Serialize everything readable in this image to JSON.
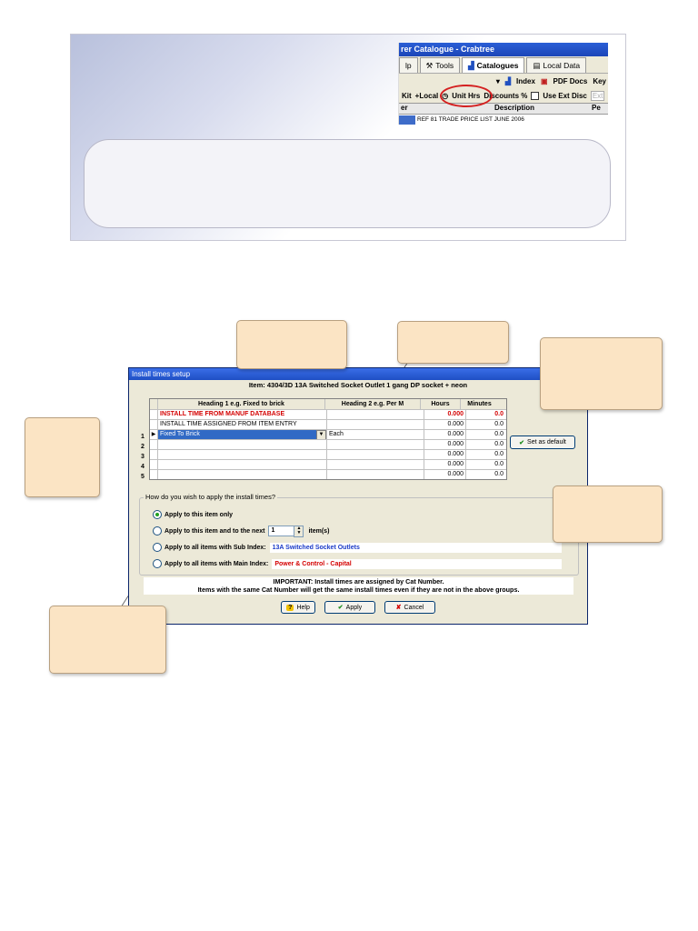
{
  "top_shot": {
    "window_title": "rer Catalogue - Crabtree",
    "tabs": [
      {
        "label": "lp",
        "icon": "none"
      },
      {
        "label": "Tools",
        "icon": "tools-icon"
      },
      {
        "label": "Catalogues",
        "icon": "catalogue-chart-icon"
      },
      {
        "label": "Local Data",
        "icon": "local-data-icon"
      }
    ],
    "toolbar": {
      "index_label": "Index",
      "pdf_label": "PDF Docs",
      "key_label": "Key"
    },
    "toolbar2": {
      "kit": "Kit",
      "local": "+Local",
      "unit_hrs": "Unit Hrs",
      "discounts": "Discounts %",
      "use_ext_disc": "Use Ext Disc",
      "ext": "Ext"
    },
    "table": {
      "col1": "er",
      "col2": "Description",
      "col3": "Pe",
      "row_text": "REF 81 TRADE PRICE LIST JUNE 2006"
    }
  },
  "dialog": {
    "title": "Install times setup",
    "item": "Item: 4304/3D 13A Switched Socket Outlet 1 gang DP socket + neon",
    "headers": [
      "Heading 1 e.g. Fixed to brick",
      "Heading 2 e.g. Per M",
      "Hours",
      "Minutes"
    ],
    "rows": [
      {
        "num": "",
        "h1": "INSTALL TIME FROM MANUF DATABASE",
        "h2": "",
        "hours": "0.000",
        "minutes": "0.0",
        "style": "red"
      },
      {
        "num": "",
        "h1": "INSTALL TIME ASSIGNED FROM ITEM ENTRY",
        "h2": "",
        "hours": "0.000",
        "minutes": "0.0",
        "style": "normal"
      },
      {
        "num": "1",
        "h1": "Fixed To Brick",
        "h2": "Each",
        "hours": "0.000",
        "minutes": "0.0",
        "style": "selected"
      },
      {
        "num": "2",
        "h1": "",
        "h2": "",
        "hours": "0.000",
        "minutes": "0.0",
        "style": "normal"
      },
      {
        "num": "3",
        "h1": "",
        "h2": "",
        "hours": "0.000",
        "minutes": "0.0",
        "style": "normal"
      },
      {
        "num": "4",
        "h1": "",
        "h2": "",
        "hours": "0.000",
        "minutes": "0.0",
        "style": "normal"
      },
      {
        "num": "5",
        "h1": "",
        "h2": "",
        "hours": "0.000",
        "minutes": "0.0",
        "style": "normal"
      }
    ],
    "set_default_label": "Set as default",
    "apply_question": "How do you wish to apply the install times?",
    "options": {
      "this_item": "Apply to this item only",
      "next_items": "Apply to this item and to the next",
      "next_count": "1",
      "items_suffix": "item(s)",
      "sub_index": "Apply to all items with Sub Index:",
      "sub_index_value": "13A Switched Socket Outlets",
      "main_index": "Apply to all items with Main Index:",
      "main_index_value": "Power & Control - Capital"
    },
    "important_line1": "IMPORTANT: Install times are assigned by Cat Number.",
    "important_line2": "Items with the same Cat Number will get the same install times even if they are not in the above groups.",
    "buttons": {
      "help": "Help",
      "apply": "Apply",
      "cancel": "Cancel"
    }
  },
  "colors": {
    "callout_fill": "#fbe4c4",
    "title_blue": "#1f4fc4",
    "red": "#d40000",
    "sub_index_blue": "#1a3ac8"
  }
}
